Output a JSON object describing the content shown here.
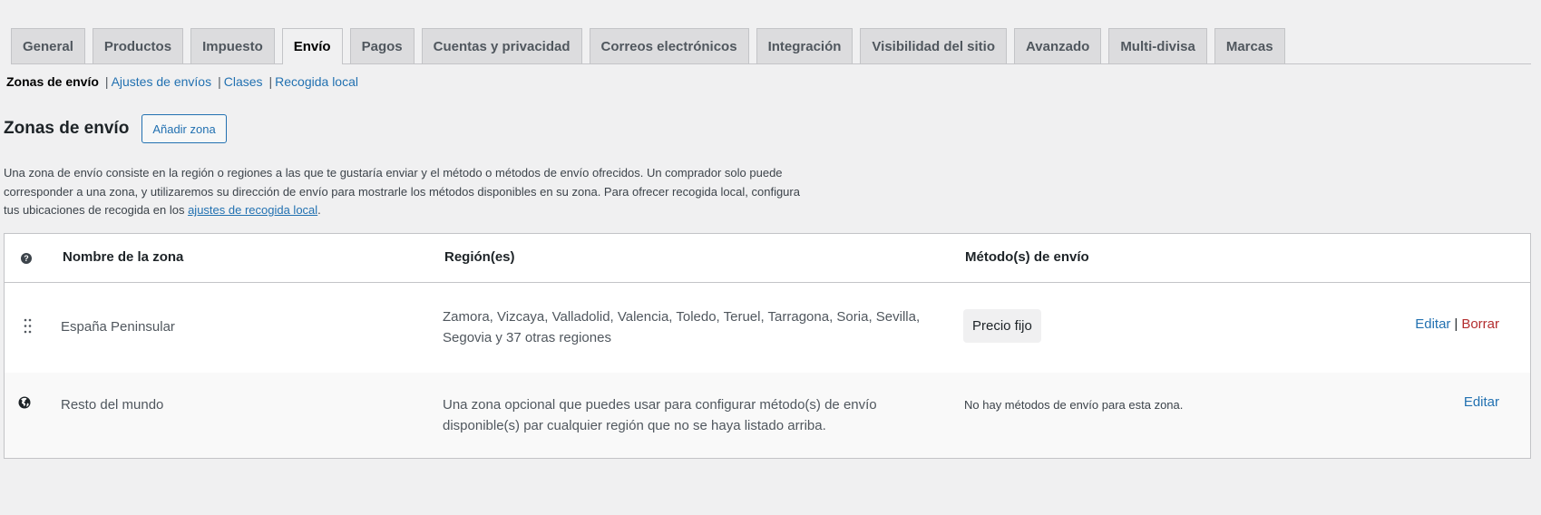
{
  "tabs": [
    {
      "label": "General"
    },
    {
      "label": "Productos"
    },
    {
      "label": "Impuesto"
    },
    {
      "label": "Envío"
    },
    {
      "label": "Pagos"
    },
    {
      "label": "Cuentas y privacidad"
    },
    {
      "label": "Correos electrónicos"
    },
    {
      "label": "Integración"
    },
    {
      "label": "Visibilidad del sitio"
    },
    {
      "label": "Avanzado"
    },
    {
      "label": "Multi-divisa"
    },
    {
      "label": "Marcas"
    }
  ],
  "active_tab": "Envío",
  "subnav": {
    "current": "Zonas de envío",
    "sep": "|",
    "links": [
      "Ajustes de envíos",
      "Clases",
      "Recogida local"
    ]
  },
  "heading": {
    "title": "Zonas de envío",
    "add_button": "Añadir zona"
  },
  "description": {
    "text": "Una zona de envío consiste en la región o regiones a las que te gustaría enviar y el método o métodos de envío ofrecidos. Un comprador solo puede corresponder a una zona, y utilizaremos su dirección de envío para mostrarle los métodos disponibles en su zona. Para ofrecer recogida local, configura tus ubicaciones de recogida en los ",
    "link": "ajustes de recogida local",
    "end": "."
  },
  "table": {
    "help_glyph": "?",
    "columns": {
      "name": "Nombre de la zona",
      "regions": "Región(es)",
      "methods": "Método(s) de envío"
    },
    "rows": [
      {
        "icon": "drag-handle-icon",
        "name": "España Peninsular",
        "regions": "Zamora, Vizcaya, Valladolid, Valencia, Toledo, Teruel, Tarragona, Soria, Sevilla, Segovia y 37 otras regiones",
        "method": "Precio fijo",
        "edit": "Editar",
        "sep": "|",
        "delete": "Borrar"
      },
      {
        "icon": "globe-icon",
        "name": "Resto del mundo",
        "regions": "Una zona opcional que puedes usar para configurar método(s) de envío disponible(s) par cualquier región que no se haya listado arriba.",
        "method_note": "No hay métodos de envío para esta zona.",
        "edit": "Editar"
      }
    ]
  },
  "colors": {
    "background": "#f0f0f1",
    "link": "#2271b1",
    "delete": "#b32d2e",
    "tab_bg": "#dcdcde"
  }
}
